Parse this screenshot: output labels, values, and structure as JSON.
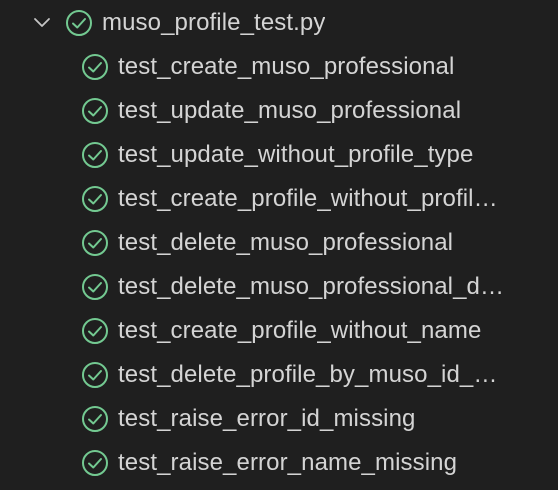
{
  "file": {
    "name": "muso_profile_test.py",
    "expanded": true,
    "chevron_icon": "chevron-down-icon",
    "status_icon": "pass-check-icon",
    "status": "passed"
  },
  "tests": [
    {
      "name": "test_create_muso_professional",
      "status": "passed"
    },
    {
      "name": "test_update_muso_professional",
      "status": "passed"
    },
    {
      "name": "test_update_without_profile_type",
      "status": "passed"
    },
    {
      "name": "test_create_profile_without_profil…",
      "status": "passed"
    },
    {
      "name": "test_delete_muso_professional",
      "status": "passed"
    },
    {
      "name": "test_delete_muso_professional_d…",
      "status": "passed"
    },
    {
      "name": "test_create_profile_without_name",
      "status": "passed"
    },
    {
      "name": "test_delete_profile_by_muso_id_…",
      "status": "passed"
    },
    {
      "name": "test_raise_error_id_missing",
      "status": "passed"
    },
    {
      "name": "test_raise_error_name_missing",
      "status": "passed"
    }
  ],
  "colors": {
    "background": "#1f1f1f",
    "pass": "#73c991",
    "text": "#d4d4d4",
    "chevron": "#c5c5c5"
  }
}
